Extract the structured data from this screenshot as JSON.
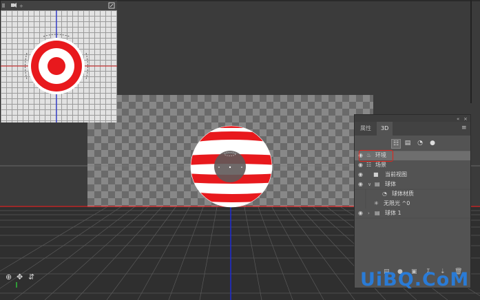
{
  "app": {
    "accent_red": "#e2231a",
    "accent_blue": "#2a7bd6"
  },
  "panel": {
    "tabs": [
      {
        "label": "属性"
      },
      {
        "label": "3D"
      }
    ],
    "layers": [
      {
        "label": "环境",
        "icon": "environment-icon",
        "visible": true,
        "selected": true
      },
      {
        "label": "场景",
        "icon": "scene-icon",
        "visible": true
      },
      {
        "label": "当前视图",
        "icon": "camera-icon",
        "visible": true
      },
      {
        "label": "球体",
        "icon": "mesh-icon",
        "visible": true
      },
      {
        "label": "球体材质",
        "icon": "material-icon",
        "visible": false
      },
      {
        "label": "无限光 ^0",
        "icon": "light-icon",
        "visible": false
      },
      {
        "label": "球体 1",
        "icon": "mesh-icon",
        "visible": true
      }
    ]
  },
  "watermark": {
    "text": "UiBQ.CoM"
  }
}
